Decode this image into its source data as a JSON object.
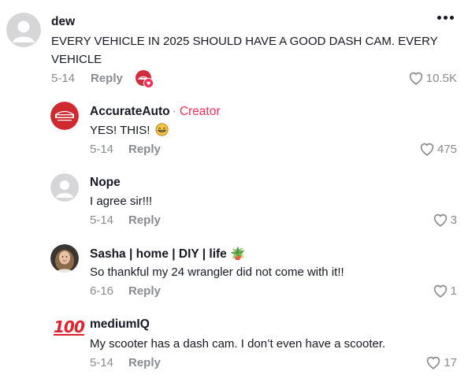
{
  "comments": [
    {
      "author": "dew",
      "text": "EVERY VEHICLE IN 2025 SHOULD HAVE A GOOD DASH CAM. EVERY VEHICLE",
      "date": "5-14",
      "reply_label": "Reply",
      "likes": "10.5K",
      "avatar_icon": "default-avatar-icon",
      "more_icon": "more-options-icon",
      "creator_liked_icon": "creator-liked-badge-icon"
    },
    {
      "author": "AccurateAuto",
      "creator_sep": "·",
      "creator_label": "Creator",
      "text": "YES! THIS!",
      "emoji": "grinning-face-icon",
      "date": "5-14",
      "reply_label": "Reply",
      "likes": "475",
      "avatar_icon": "accurate-auto-logo"
    },
    {
      "author": "Nope",
      "text": "I agree sir!!!",
      "date": "5-14",
      "reply_label": "Reply",
      "likes": "3",
      "avatar_icon": "default-avatar-icon"
    },
    {
      "author": "Sasha | home | DIY | life 🪴",
      "text": "So thankful my 24 wrangler did not come with it!!",
      "date": "6-16",
      "reply_label": "Reply",
      "likes": "1",
      "avatar_icon": "user-photo-avatar"
    },
    {
      "author": "mediumIQ",
      "text": "My scooter has a dash cam. I don’t even have a scooter.",
      "date": "5-14",
      "reply_label": "Reply",
      "likes": "17",
      "avatar_icon": "hundred-points-emoji-avatar",
      "avatar_glyph": "100"
    }
  ],
  "colors": {
    "text": "#161823",
    "muted": "#8a8b91",
    "creator": "#fe2c55"
  }
}
